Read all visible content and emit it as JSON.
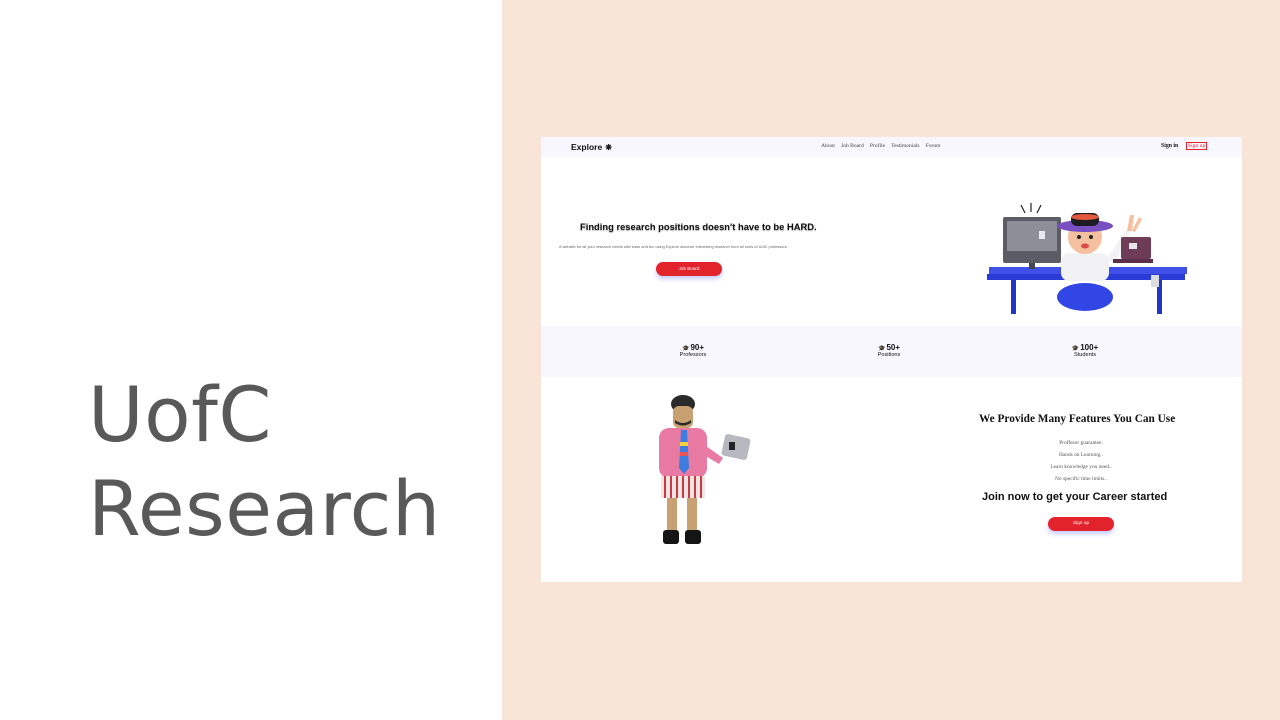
{
  "slide": {
    "title_line1": "UofC",
    "title_line2": "Research"
  },
  "site": {
    "brand": "Explore",
    "brand_icon": "flower-icon",
    "nav": [
      "About",
      "Job Board",
      "Profile",
      "Testimonials",
      "Forum"
    ],
    "signin": "Sign in",
    "signup": "Sign up",
    "hero": {
      "title": "Finding research positions doesn't have to be HARD.",
      "subtitle": "A website for all your research needs with ease and fun using Explore discover interesting research from all sorts of UofC professors.",
      "button": "Job Board"
    },
    "stats": [
      {
        "value": "90+",
        "label": "Professors"
      },
      {
        "value": "50+",
        "label": "Positions"
      },
      {
        "value": "100+",
        "label": "Students"
      }
    ],
    "features": {
      "title": "We Provide Many Features You Can Use",
      "items": [
        "Proffesor guarantee.",
        "Hands on Learning..",
        "Learn knowledge you need..",
        "No specific time limits.."
      ],
      "cta_title": "Join now to get your Career started",
      "cta_button": "Sign up"
    }
  },
  "colors": {
    "accent_red": "#e3232c",
    "panel_peach": "#f9e4d8",
    "title_gray": "#595959",
    "nav_bg": "#f7f7fd"
  }
}
